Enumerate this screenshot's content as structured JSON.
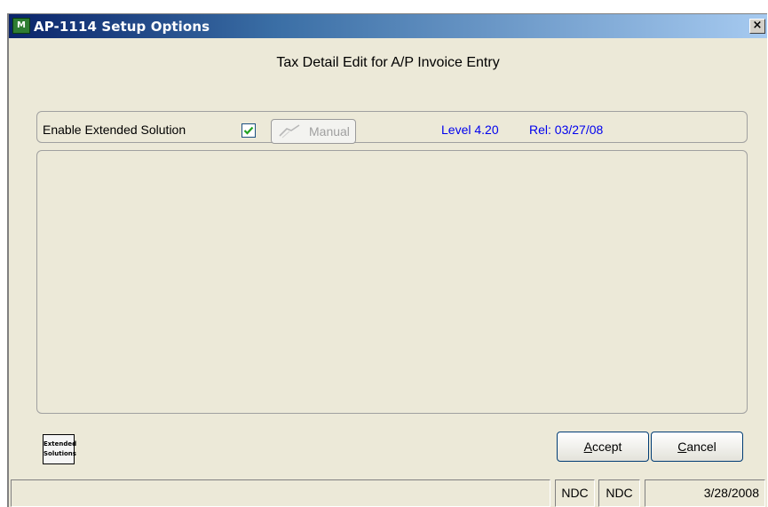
{
  "window": {
    "title": "AP-1114 Setup Options",
    "app_icon": "mas-app-icon",
    "close_label": "×"
  },
  "header": {
    "title": "Tax Detail Edit for A/P Invoice Entry"
  },
  "options": {
    "enable_label": "Enable Extended Solution",
    "enable_checked": true,
    "manual_label": "Manual",
    "manual_enabled": false,
    "level": "Level 4.20",
    "release": "Rel: 03/27/08"
  },
  "logo": {
    "line1": "Extended",
    "line2": "Solutions"
  },
  "buttons": {
    "accept_accel": "A",
    "accept_rest": "ccept",
    "cancel_accel": "C",
    "cancel_rest": "ancel"
  },
  "status": {
    "message": "",
    "company1": "NDC",
    "company2": "NDC",
    "date": "3/28/2008"
  },
  "colors": {
    "version_text": "#0000ee",
    "title_bar": "#0a246a"
  }
}
